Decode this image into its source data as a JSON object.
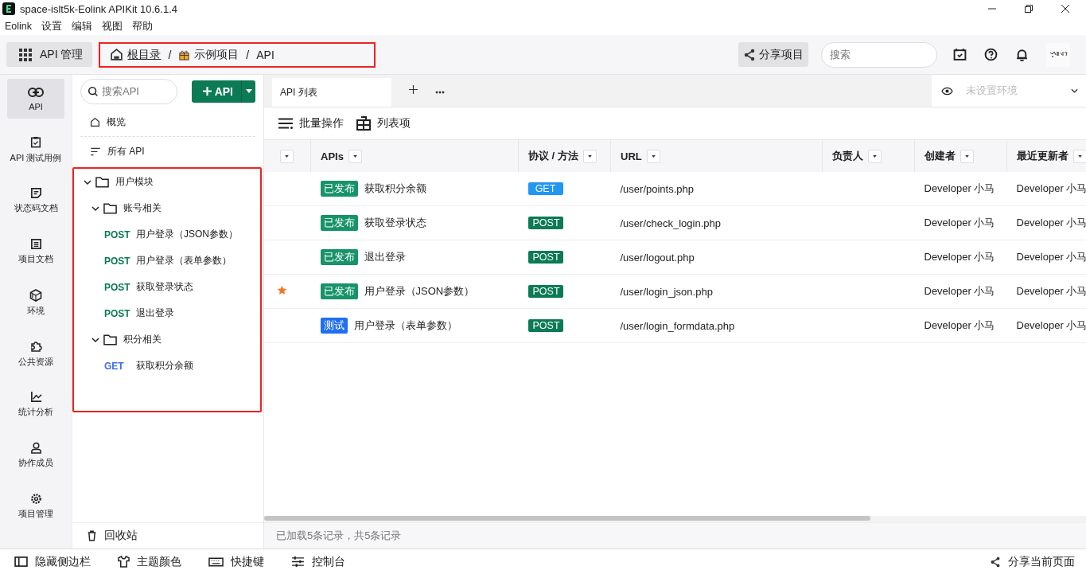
{
  "window": {
    "title": "space-islt5k-Eolink APIKit 10.6.1.4"
  },
  "menu": [
    "Eolink",
    "设置",
    "编辑",
    "视图",
    "帮助"
  ],
  "topbar": {
    "app_button": "API 管理",
    "breadcrumb_highlighted": true,
    "breadcrumb": [
      {
        "kind": "home",
        "text": "根目录"
      },
      {
        "kind": "separator",
        "text": "/"
      },
      {
        "kind": "gift",
        "text": "示例项目"
      },
      {
        "kind": "separator",
        "text": "/"
      },
      {
        "kind": "plain",
        "text": "API"
      }
    ],
    "share_button": "分享项目",
    "search": {
      "placeholder": "搜索"
    }
  },
  "nav_rail": [
    {
      "label": "API",
      "selected": true
    },
    {
      "label": "API 测试用例",
      "selected": false
    },
    {
      "label": "状态码文档",
      "selected": false
    },
    {
      "label": "项目文档",
      "selected": false
    },
    {
      "label": "环境",
      "selected": false
    },
    {
      "label": "公共资源",
      "selected": false
    },
    {
      "label": "统计分析",
      "selected": false
    },
    {
      "label": "协作成员",
      "selected": false
    },
    {
      "label": "项目管理",
      "selected": false
    }
  ],
  "tree_panel": {
    "search": {
      "placeholder": "搜索API"
    },
    "add_button": "API",
    "overview": "概览",
    "all_apis": "所有 API",
    "tree_highlighted": true,
    "tree": [
      {
        "kind": "folder",
        "label": "用户模块",
        "expanded": true,
        "children": [
          {
            "kind": "folder",
            "label": "账号相关",
            "expanded": true,
            "children": [
              {
                "kind": "api",
                "method": "POST",
                "label": "用户登录（JSON参数）"
              },
              {
                "kind": "api",
                "method": "POST",
                "label": "用户登录（表单参数）"
              },
              {
                "kind": "api",
                "method": "POST",
                "label": "获取登录状态"
              },
              {
                "kind": "api",
                "method": "POST",
                "label": "退出登录"
              }
            ]
          },
          {
            "kind": "folder",
            "label": "积分相关",
            "expanded": true,
            "children": [
              {
                "kind": "api",
                "method": "GET",
                "label": "获取积分余额"
              }
            ]
          }
        ]
      }
    ],
    "recycle_bin": "回收站"
  },
  "tabs": [
    {
      "label": "API 列表",
      "selected": true
    }
  ],
  "environment": {
    "placeholder": "未设置环境"
  },
  "actions": [
    "批量操作",
    "列表项"
  ],
  "table": {
    "columns": [
      "APIs",
      "协议 / 方法",
      "URL",
      "负责人",
      "创建者",
      "最近更新者"
    ],
    "rows": [
      {
        "starred": false,
        "status": {
          "kind": "published",
          "text": "已发布"
        },
        "name": "获取积分余额",
        "method": "GET",
        "url": "/user/points.php",
        "creator": "Developer 小马",
        "updater": "Developer 小马"
      },
      {
        "starred": false,
        "status": {
          "kind": "published",
          "text": "已发布"
        },
        "name": "获取登录状态",
        "method": "POST",
        "url": "/user/check_login.php",
        "creator": "Developer 小马",
        "updater": "Developer 小马"
      },
      {
        "starred": false,
        "status": {
          "kind": "published",
          "text": "已发布"
        },
        "name": "退出登录",
        "method": "POST",
        "url": "/user/logout.php",
        "creator": "Developer 小马",
        "updater": "Developer 小马"
      },
      {
        "starred": true,
        "status": {
          "kind": "published",
          "text": "已发布"
        },
        "name": "用户登录（JSON参数）",
        "method": "POST",
        "url": "/user/login_json.php",
        "creator": "Developer 小马",
        "updater": "Developer 小马"
      },
      {
        "starred": false,
        "status": {
          "kind": "testing",
          "text": "测试"
        },
        "name": "用户登录（表单参数）",
        "method": "POST",
        "url": "/user/login_formdata.php",
        "creator": "Developer 小马",
        "updater": "Developer 小马"
      }
    ]
  },
  "status_bar": "已加载5条记录，共5条记录",
  "bottom_bar": {
    "items": [
      "隐藏侧边栏",
      "主题颜色",
      "快捷键",
      "控制台"
    ],
    "share_page": "分享当前页面"
  }
}
